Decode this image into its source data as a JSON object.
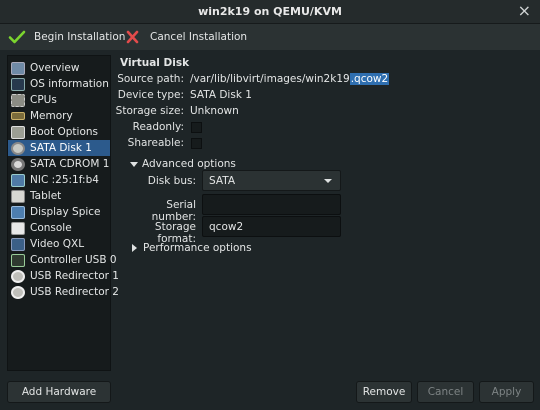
{
  "window": {
    "title": "win2k19 on QEMU/KVM"
  },
  "toolbar": {
    "begin_label": "Begin Installation",
    "cancel_label": "Cancel Installation",
    "begin_icon": "check-icon",
    "cancel_icon": "x-icon",
    "begin_color": "#7bd42e",
    "cancel_color": "#e34b4b"
  },
  "sidebar": {
    "items": [
      {
        "label": "Overview",
        "icon": "overview-icon"
      },
      {
        "label": "OS information",
        "icon": "os-icon"
      },
      {
        "label": "CPUs",
        "icon": "cpu-icon"
      },
      {
        "label": "Memory",
        "icon": "memory-icon"
      },
      {
        "label": "Boot Options",
        "icon": "boot-icon"
      },
      {
        "label": "SATA Disk 1",
        "icon": "disk-icon",
        "selected": true
      },
      {
        "label": "SATA CDROM 1",
        "icon": "cdrom-icon"
      },
      {
        "label": "NIC :25:1f:b4",
        "icon": "nic-icon"
      },
      {
        "label": "Tablet",
        "icon": "tablet-icon"
      },
      {
        "label": "Display Spice",
        "icon": "display-icon"
      },
      {
        "label": "Console",
        "icon": "console-icon"
      },
      {
        "label": "Video QXL",
        "icon": "video-icon"
      },
      {
        "label": "Controller USB 0",
        "icon": "usb-controller-icon"
      },
      {
        "label": "USB Redirector 1",
        "icon": "usb-redirector-icon"
      },
      {
        "label": "USB Redirector 2",
        "icon": "usb-redirector-icon"
      }
    ],
    "add_hardware_label": "Add Hardware"
  },
  "details": {
    "section_title": "Virtual Disk",
    "source_path_label": "Source path:",
    "source_path_value": "/var/lib/libvirt/images/win2k19",
    "source_path_ext": ".qcow2",
    "device_type_label": "Device type:",
    "device_type_value": "SATA Disk 1",
    "storage_size_label": "Storage size:",
    "storage_size_value": "Unknown",
    "readonly_label": "Readonly:",
    "shareable_label": "Shareable:",
    "advanced_label": "Advanced options",
    "disk_bus_label": "Disk bus:",
    "disk_bus_value": "SATA",
    "serial_label": "Serial number:",
    "serial_value": "",
    "storage_format_label": "Storage format:",
    "storage_format_value": "qcow2",
    "performance_label": "Performance options"
  },
  "buttons": {
    "remove": "Remove",
    "cancel": "Cancel",
    "apply": "Apply"
  }
}
